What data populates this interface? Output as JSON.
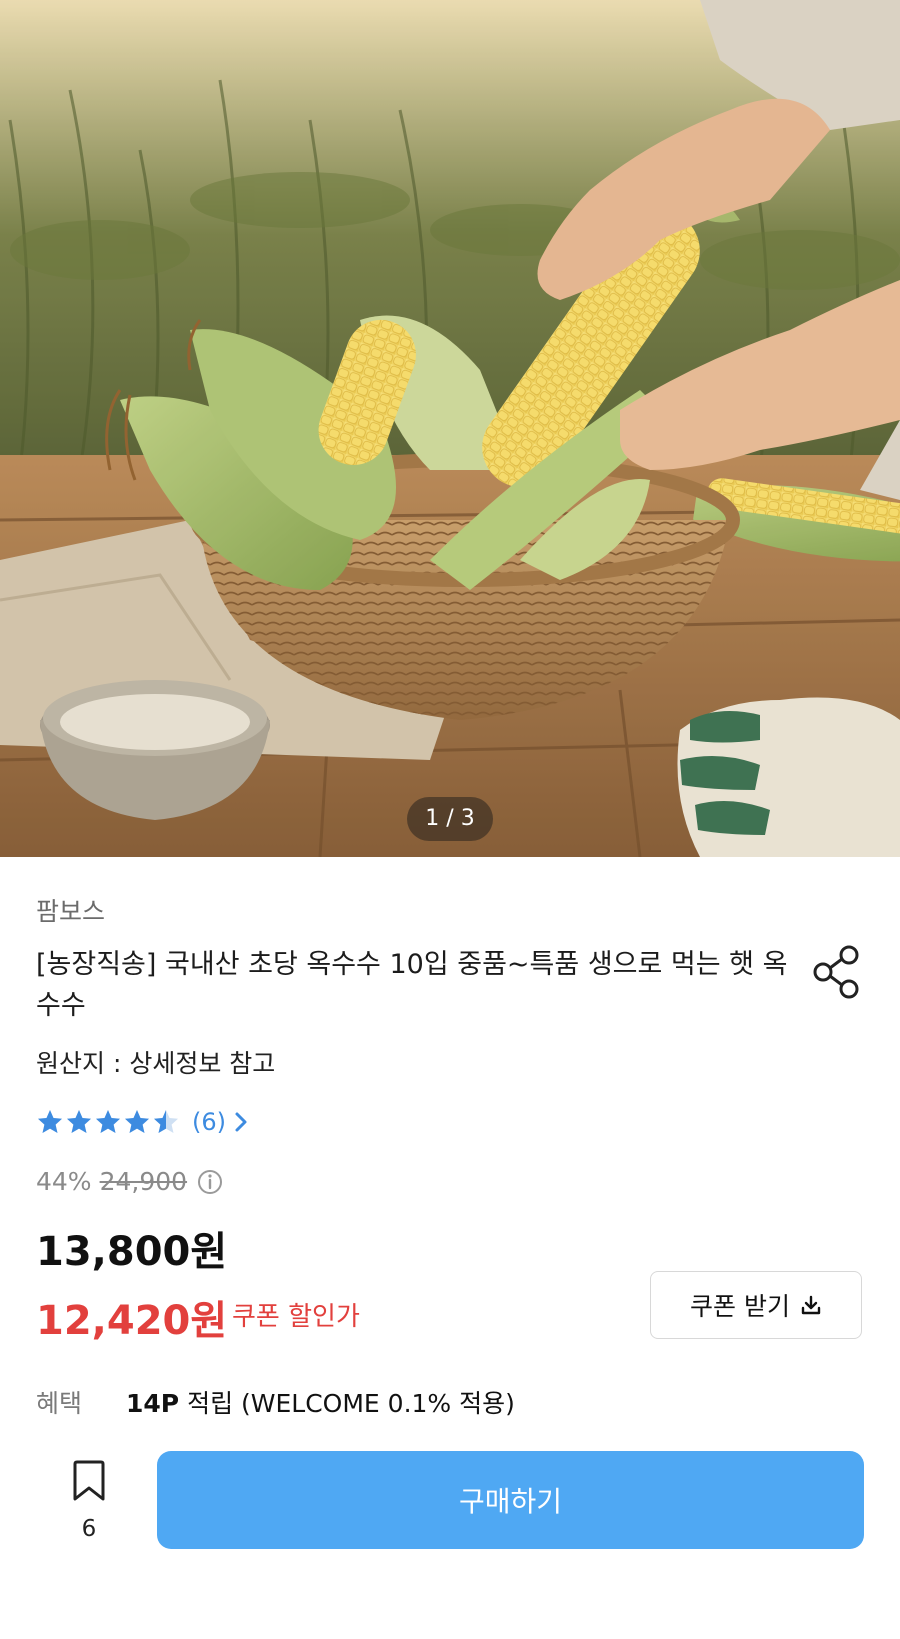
{
  "hero": {
    "pager_current": "1",
    "pager_total": "3",
    "pager_text": "1 / 3"
  },
  "product": {
    "brand": "팜보스",
    "title": "[농장직송] 국내산 초당 옥수수 10입 중품~특품 생으로 먹는 햇 옥수수",
    "origin": "원산지 : 상세정보 참고",
    "rating": 4.5,
    "review_count_text": "(6)",
    "discount_rate": "44%",
    "original_price": "24,900",
    "price": "13,800원",
    "coupon_price": "12,420원",
    "coupon_price_label": "쿠폰 할인가",
    "coupon_button_label": "쿠폰 받기",
    "benefit_label": "혜택",
    "benefit_points": "14P",
    "benefit_rest": " 적립 (WELCOME 0.1% 적용)"
  },
  "footer": {
    "bookmark_count": "6",
    "buy_label": "구매하기"
  },
  "colors": {
    "accent_blue": "#4fa8f3",
    "star_blue": "#3d8be0",
    "sale_red": "#e2403d"
  },
  "icons": [
    "share-icon",
    "star-icon",
    "chevron-right-icon",
    "info-icon",
    "download-icon",
    "bookmark-icon"
  ]
}
